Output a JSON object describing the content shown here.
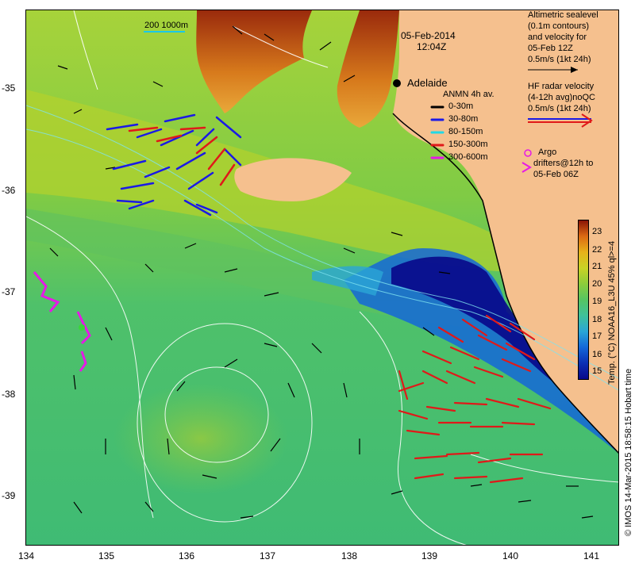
{
  "header": {
    "date": "05-Feb-2014",
    "time": "12:04Z"
  },
  "scale_bar": {
    "label": "200  1000m"
  },
  "place": {
    "city": "Adelaide"
  },
  "legend_sealevel": {
    "line1": "Altimetric sealevel",
    "line2": "(0.1m contours)",
    "line3": "and velocity for",
    "line4": "05-Feb 12Z",
    "line5": "0.5m/s (1kt 24h)"
  },
  "legend_hf": {
    "line1": "HF radar velocity",
    "line2": "(4-12h avg)noQC",
    "line3": "0.5m/s (1kt 24h)"
  },
  "legend_anmn": {
    "title": "ANMN 4h av.",
    "items": [
      {
        "label": "0-30m",
        "color": "#000000"
      },
      {
        "label": "30-80m",
        "color": "#1a1ae6"
      },
      {
        "label": "80-150m",
        "color": "#21d9e6"
      },
      {
        "label": "150-300m",
        "color": "#e01919"
      },
      {
        "label": "300-600m",
        "color": "#e619e6"
      }
    ]
  },
  "legend_argo": {
    "line1": "Argo",
    "line2": "drifters@12h to",
    "line3": "05-Feb 06Z",
    "color": "#e619e6"
  },
  "colorbar": {
    "label": "Temp. (°C) NOAA16_L3U 45% ql>=4",
    "ticks": [
      "23",
      "22",
      "21",
      "20",
      "19",
      "18",
      "17",
      "16",
      "15"
    ]
  },
  "credit": "© IMOS 14-Mar-2015 18:58:15 Hobart time",
  "axes": {
    "x_ticks": [
      "134",
      "135",
      "136",
      "137",
      "138",
      "139",
      "140",
      "141"
    ],
    "y_ticks": [
      "-35",
      "-36",
      "-37",
      "-38",
      "-39"
    ]
  },
  "colors": {
    "land": "#f5c08e",
    "sea_warm": "#8ccc3b",
    "sea_mid": "#56c462",
    "upwelling": "#0b2fb4",
    "hf_arrow": "#e01919",
    "anmn_arrow": "#1a1ae6"
  }
}
